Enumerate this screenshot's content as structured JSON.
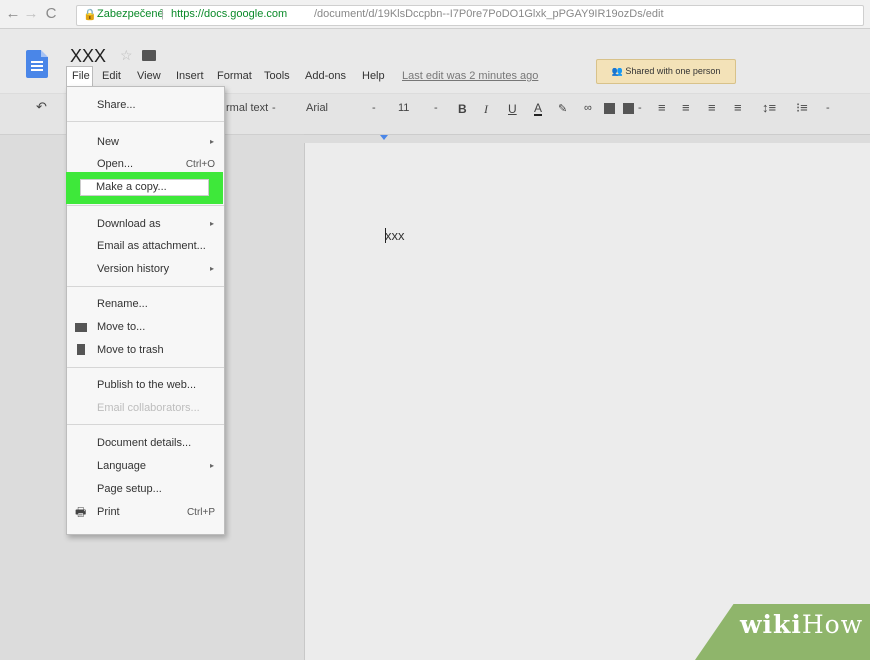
{
  "browser": {
    "secure_label": "Zabezpečené",
    "url_host": "https://docs.google.com",
    "url_path": "/document/d/19KlsDccpbn--I7P0re7PoDO1Glxk_pPGAY9IR19ozDs/edit"
  },
  "doc": {
    "title": "XXX",
    "body_text": "xxx"
  },
  "menubar": {
    "items": [
      "File",
      "Edit",
      "View",
      "Insert",
      "Format",
      "Tools",
      "Add-ons",
      "Help"
    ],
    "last_edit": "Last edit was 2 minutes ago",
    "shared_label": "Shared with one person"
  },
  "toolbar": {
    "style_label": "rmal text",
    "font_label": "Arial",
    "size_label": "11"
  },
  "file_menu": {
    "share": "Share...",
    "new": "New",
    "open": "Open...",
    "open_shortcut": "Ctrl+O",
    "make_copy": "Make a copy...",
    "download_as": "Download as",
    "email_attachment": "Email as attachment...",
    "version_history": "Version history",
    "rename": "Rename...",
    "move_to": "Move to...",
    "move_to_trash": "Move to trash",
    "publish": "Publish to the web...",
    "email_collaborators": "Email collaborators...",
    "document_details": "Document details...",
    "language": "Language",
    "page_setup": "Page setup...",
    "print": "Print",
    "print_shortcut": "Ctrl+P"
  },
  "watermark": {
    "prefix": "wiki",
    "suffix": "How"
  },
  "colors": {
    "highlight": "#3ee83a",
    "docs_blue": "#4a86e8",
    "shared_bg": "#f3e2b8"
  }
}
